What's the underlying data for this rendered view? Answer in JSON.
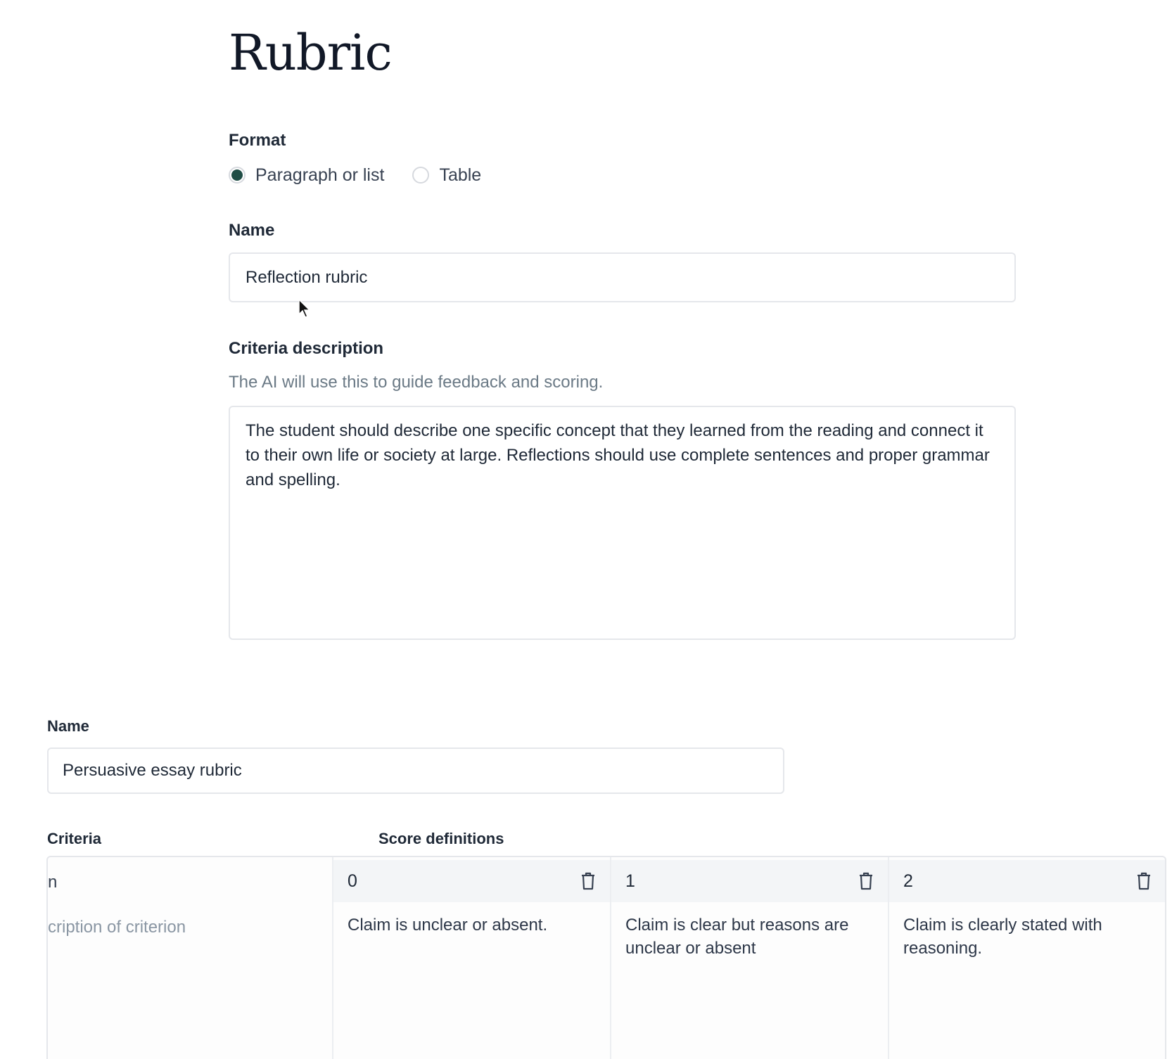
{
  "page": {
    "title": "Rubric"
  },
  "format": {
    "label": "Format",
    "options": [
      {
        "label": "Paragraph or list",
        "selected": true
      },
      {
        "label": "Table",
        "selected": false
      }
    ]
  },
  "name_field": {
    "label": "Name",
    "value": "Reflection rubric"
  },
  "criteria": {
    "label": "Criteria description",
    "helper": "The AI will use this to guide feedback and scoring.",
    "value": "The student should describe one specific concept that they learned from the reading and connect it to their own life or society at large. Reflections should use complete sentences and proper grammar and spelling."
  },
  "table_rubric": {
    "name_label": "Name",
    "name_value": "Persuasive essay rubric",
    "criteria_header": "Criteria",
    "score_header": "Score definitions",
    "criterion_name_fragment": "n",
    "criterion_desc_fragment": "cription of criterion",
    "scores": [
      {
        "score": "0",
        "definition": "Claim is unclear or absent."
      },
      {
        "score": "1",
        "definition": "Claim is clear but reasons are unclear or absent"
      },
      {
        "score": "2",
        "definition": "Claim is clearly stated with reasoning."
      }
    ]
  },
  "colors": {
    "accent": "#1f4d45",
    "helper_text": "#6b7a86",
    "border": "#e5e7eb"
  },
  "icons": [
    "cursor-arrow-icon",
    "trash-icon"
  ]
}
